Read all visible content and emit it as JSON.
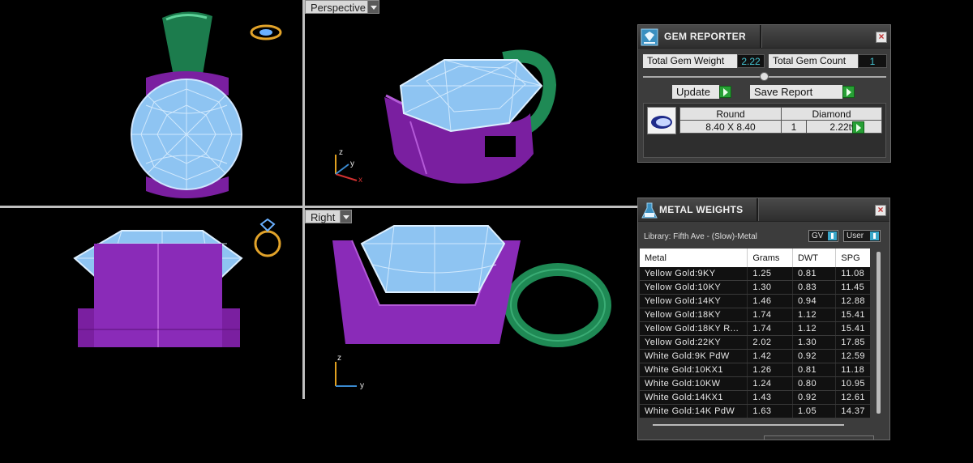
{
  "viewports": {
    "perspective_label": "Perspective",
    "right_label": "Right",
    "axis": {
      "x": "x",
      "y": "y",
      "z": "z"
    }
  },
  "gem_reporter": {
    "title": "GEM REPORTER",
    "total_gem_weight_label": "Total Gem Weight",
    "total_gem_weight_value": "2.22",
    "total_gem_count_label": "Total Gem Count",
    "total_gem_count_value": "1",
    "update_label": "Update",
    "save_report_label": "Save Report",
    "gem_row": {
      "shape": "Round",
      "type": "Diamond",
      "size": "8.40 X 8.40",
      "count": "1",
      "weight": "2.22tw"
    }
  },
  "metal_weights": {
    "title": "METAL WEIGHTS",
    "library": "Library: Fifth Ave - (Slow)-Metal",
    "gv_label": "GV",
    "user_label": "User",
    "columns": [
      "Metal",
      "Grams",
      "DWT",
      "SPG"
    ],
    "rows": [
      [
        "Yellow Gold:9KY",
        "1.25",
        "0.81",
        "11.08"
      ],
      [
        "Yellow Gold:10KY",
        "1.30",
        "0.83",
        "11.45"
      ],
      [
        "Yellow Gold:14KY",
        "1.46",
        "0.94",
        "12.88"
      ],
      [
        "Yellow Gold:18KY",
        "1.74",
        "1.12",
        "15.41"
      ],
      [
        "Yellow Gold:18KY R...",
        "1.74",
        "1.12",
        "15.41"
      ],
      [
        "Yellow Gold:22KY",
        "2.02",
        "1.30",
        "17.85"
      ],
      [
        "White Gold:9K PdW",
        "1.42",
        "0.92",
        "12.59"
      ],
      [
        "White Gold:10KX1",
        "1.26",
        "0.81",
        "11.18"
      ],
      [
        "White Gold:10KW",
        "1.24",
        "0.80",
        "10.95"
      ],
      [
        "White Gold:14KX1",
        "1.43",
        "0.92",
        "12.61"
      ],
      [
        "White Gold:14K PdW",
        "1.63",
        "1.05",
        "14.37"
      ]
    ]
  }
}
